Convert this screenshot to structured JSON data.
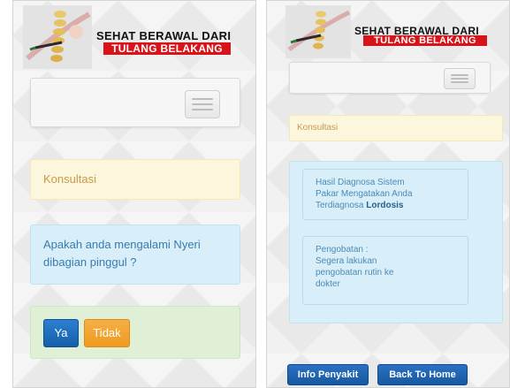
{
  "left_screen": {
    "banner": {
      "line1": "SEHAT BERAWAL DARI",
      "line2": "TULANG BELAKANG",
      "art_icon": "spine-illustration-icon"
    },
    "menu_icon": "hamburger-menu-icon",
    "consult_panel": {
      "label": "Konsultasi"
    },
    "question_panel": {
      "line1": "Apakah anda mengalami Nyeri",
      "line2": "dibagian pinggul ?"
    },
    "answer_buttons": {
      "yes_label": "Ya",
      "no_label": "Tidak"
    }
  },
  "right_screen": {
    "banner": {
      "line1": "SEHAT BERAWAL DARI",
      "line2": "TULANG BELAKANG",
      "art_icon": "spine-illustration-icon"
    },
    "menu_icon": "hamburger-menu-icon",
    "consult_panel": {
      "label": "Konsultasi"
    },
    "diagnosis": {
      "line1": "Hasil Diagnosa Sistem",
      "line2": "Pakar Mengatakan Anda",
      "line3_prefix": "Terdiagnosa ",
      "result": "Lordosis"
    },
    "treatment": {
      "line1": "Pengobatan :",
      "line2": "Segera lakukan",
      "line3": "pengobatan rutin ke",
      "line4": "dokter"
    },
    "footer_buttons": {
      "info_label": "Info Penyakit",
      "home_label": "Back To Home"
    }
  },
  "colors": {
    "brand_red": "#d7141a",
    "panel_yellow": "#fcf6dc",
    "panel_blue": "#d8eef8",
    "panel_green": "#dff0d6",
    "button_blue": "#1e6fbf",
    "button_orange": "#f2a332"
  }
}
